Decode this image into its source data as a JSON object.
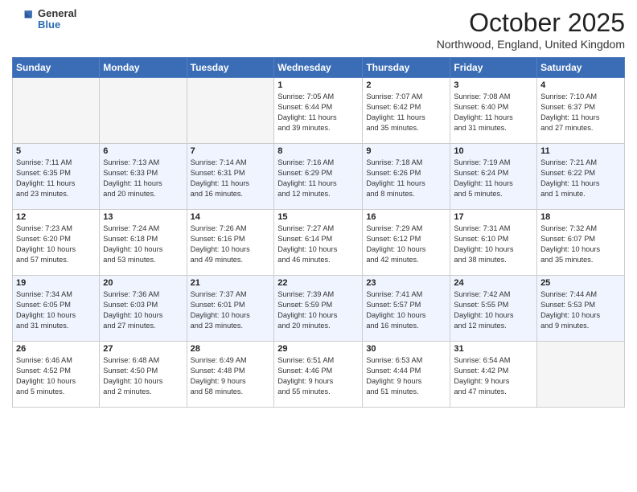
{
  "header": {
    "logo": {
      "general": "General",
      "blue": "Blue"
    },
    "title": "October 2025",
    "location": "Northwood, England, United Kingdom"
  },
  "weekdays": [
    "Sunday",
    "Monday",
    "Tuesday",
    "Wednesday",
    "Thursday",
    "Friday",
    "Saturday"
  ],
  "weeks": [
    [
      {
        "day": "",
        "info": ""
      },
      {
        "day": "",
        "info": ""
      },
      {
        "day": "",
        "info": ""
      },
      {
        "day": "1",
        "info": "Sunrise: 7:05 AM\nSunset: 6:44 PM\nDaylight: 11 hours\nand 39 minutes."
      },
      {
        "day": "2",
        "info": "Sunrise: 7:07 AM\nSunset: 6:42 PM\nDaylight: 11 hours\nand 35 minutes."
      },
      {
        "day": "3",
        "info": "Sunrise: 7:08 AM\nSunset: 6:40 PM\nDaylight: 11 hours\nand 31 minutes."
      },
      {
        "day": "4",
        "info": "Sunrise: 7:10 AM\nSunset: 6:37 PM\nDaylight: 11 hours\nand 27 minutes."
      }
    ],
    [
      {
        "day": "5",
        "info": "Sunrise: 7:11 AM\nSunset: 6:35 PM\nDaylight: 11 hours\nand 23 minutes."
      },
      {
        "day": "6",
        "info": "Sunrise: 7:13 AM\nSunset: 6:33 PM\nDaylight: 11 hours\nand 20 minutes."
      },
      {
        "day": "7",
        "info": "Sunrise: 7:14 AM\nSunset: 6:31 PM\nDaylight: 11 hours\nand 16 minutes."
      },
      {
        "day": "8",
        "info": "Sunrise: 7:16 AM\nSunset: 6:29 PM\nDaylight: 11 hours\nand 12 minutes."
      },
      {
        "day": "9",
        "info": "Sunrise: 7:18 AM\nSunset: 6:26 PM\nDaylight: 11 hours\nand 8 minutes."
      },
      {
        "day": "10",
        "info": "Sunrise: 7:19 AM\nSunset: 6:24 PM\nDaylight: 11 hours\nand 5 minutes."
      },
      {
        "day": "11",
        "info": "Sunrise: 7:21 AM\nSunset: 6:22 PM\nDaylight: 11 hours\nand 1 minute."
      }
    ],
    [
      {
        "day": "12",
        "info": "Sunrise: 7:23 AM\nSunset: 6:20 PM\nDaylight: 10 hours\nand 57 minutes."
      },
      {
        "day": "13",
        "info": "Sunrise: 7:24 AM\nSunset: 6:18 PM\nDaylight: 10 hours\nand 53 minutes."
      },
      {
        "day": "14",
        "info": "Sunrise: 7:26 AM\nSunset: 6:16 PM\nDaylight: 10 hours\nand 49 minutes."
      },
      {
        "day": "15",
        "info": "Sunrise: 7:27 AM\nSunset: 6:14 PM\nDaylight: 10 hours\nand 46 minutes."
      },
      {
        "day": "16",
        "info": "Sunrise: 7:29 AM\nSunset: 6:12 PM\nDaylight: 10 hours\nand 42 minutes."
      },
      {
        "day": "17",
        "info": "Sunrise: 7:31 AM\nSunset: 6:10 PM\nDaylight: 10 hours\nand 38 minutes."
      },
      {
        "day": "18",
        "info": "Sunrise: 7:32 AM\nSunset: 6:07 PM\nDaylight: 10 hours\nand 35 minutes."
      }
    ],
    [
      {
        "day": "19",
        "info": "Sunrise: 7:34 AM\nSunset: 6:05 PM\nDaylight: 10 hours\nand 31 minutes."
      },
      {
        "day": "20",
        "info": "Sunrise: 7:36 AM\nSunset: 6:03 PM\nDaylight: 10 hours\nand 27 minutes."
      },
      {
        "day": "21",
        "info": "Sunrise: 7:37 AM\nSunset: 6:01 PM\nDaylight: 10 hours\nand 23 minutes."
      },
      {
        "day": "22",
        "info": "Sunrise: 7:39 AM\nSunset: 5:59 PM\nDaylight: 10 hours\nand 20 minutes."
      },
      {
        "day": "23",
        "info": "Sunrise: 7:41 AM\nSunset: 5:57 PM\nDaylight: 10 hours\nand 16 minutes."
      },
      {
        "day": "24",
        "info": "Sunrise: 7:42 AM\nSunset: 5:55 PM\nDaylight: 10 hours\nand 12 minutes."
      },
      {
        "day": "25",
        "info": "Sunrise: 7:44 AM\nSunset: 5:53 PM\nDaylight: 10 hours\nand 9 minutes."
      }
    ],
    [
      {
        "day": "26",
        "info": "Sunrise: 6:46 AM\nSunset: 4:52 PM\nDaylight: 10 hours\nand 5 minutes."
      },
      {
        "day": "27",
        "info": "Sunrise: 6:48 AM\nSunset: 4:50 PM\nDaylight: 10 hours\nand 2 minutes."
      },
      {
        "day": "28",
        "info": "Sunrise: 6:49 AM\nSunset: 4:48 PM\nDaylight: 9 hours\nand 58 minutes."
      },
      {
        "day": "29",
        "info": "Sunrise: 6:51 AM\nSunset: 4:46 PM\nDaylight: 9 hours\nand 55 minutes."
      },
      {
        "day": "30",
        "info": "Sunrise: 6:53 AM\nSunset: 4:44 PM\nDaylight: 9 hours\nand 51 minutes."
      },
      {
        "day": "31",
        "info": "Sunrise: 6:54 AM\nSunset: 4:42 PM\nDaylight: 9 hours\nand 47 minutes."
      },
      {
        "day": "",
        "info": ""
      }
    ]
  ]
}
